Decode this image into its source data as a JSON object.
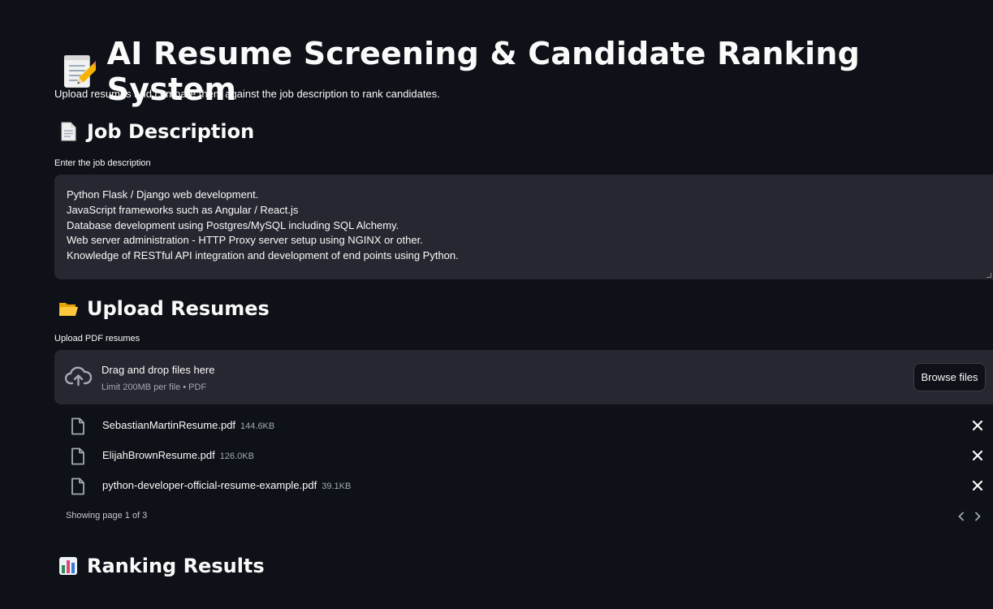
{
  "header": {
    "title": "AI Resume Screening & Candidate Ranking System",
    "title_icon": "memo-pencil-icon",
    "subtitle": "Upload resumes and compare them against the job description to rank candidates."
  },
  "job_description": {
    "heading": "Job Description",
    "heading_icon": "page-icon",
    "label": "Enter the job description",
    "lines": [
      "Python Flask / Django web development.",
      "JavaScript frameworks such as Angular / React.js",
      "Database development using Postgres/MySQL including SQL Alchemy.",
      "Web server administration - HTTP Proxy server setup using NGINX or other.",
      "Knowledge of RESTful API integration and development of end points using Python."
    ]
  },
  "upload": {
    "heading": "Upload Resumes",
    "heading_icon": "folder-icon",
    "label": "Upload PDF resumes",
    "dropzone_text": "Drag and drop files here",
    "dropzone_limit": "Limit 200MB per file • PDF",
    "browse_label": "Browse files",
    "files": [
      {
        "name": "SebastianMartinResume.pdf",
        "size": "144.6KB"
      },
      {
        "name": "ElijahBrownResume.pdf",
        "size": "126.0KB"
      },
      {
        "name": "python-developer-official-resume-example.pdf",
        "size": "39.1KB"
      }
    ],
    "pagination": "Showing page 1 of 3"
  },
  "results": {
    "heading": "Ranking Results",
    "heading_icon": "bar-chart-icon"
  },
  "colors": {
    "background": "#0e1117",
    "surface": "#262730",
    "text": "#fafafa",
    "muted": "#a3a8b4"
  }
}
